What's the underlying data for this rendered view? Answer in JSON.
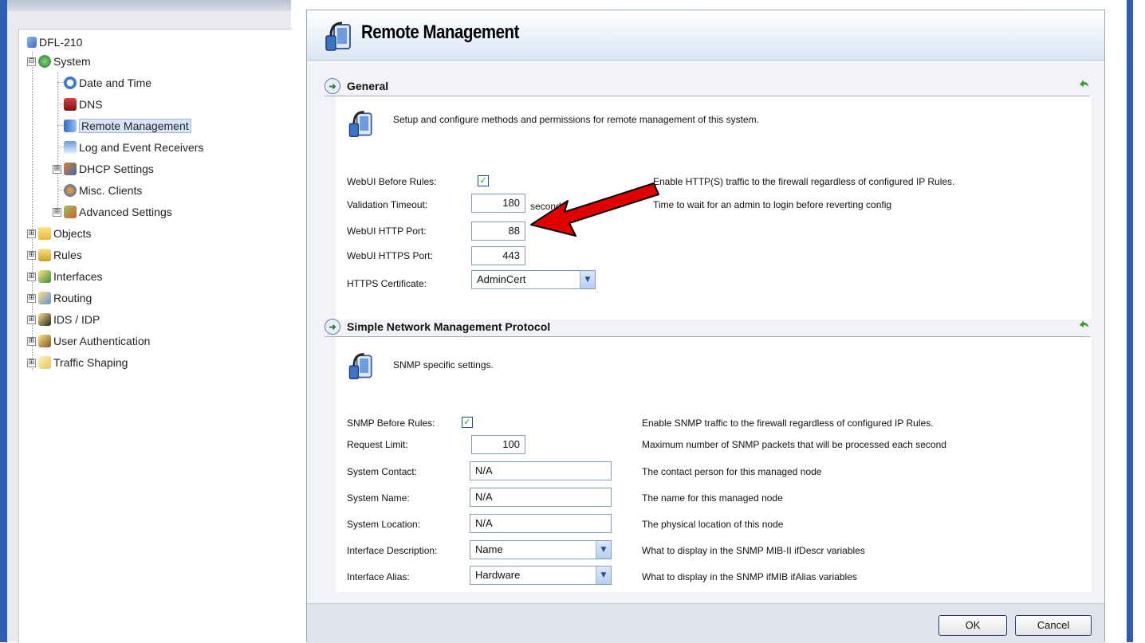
{
  "tree": {
    "root": "DFL-210",
    "items": [
      {
        "label": "System",
        "icon": "system-icon",
        "expander": "⊟"
      },
      {
        "label": "Date and Time",
        "icon": "clock-icon"
      },
      {
        "label": "DNS",
        "icon": "dns-icon"
      },
      {
        "label": "Remote Management",
        "icon": "remote-management-icon",
        "selected": true
      },
      {
        "label": "Log and Event Receivers",
        "icon": "log-icon"
      },
      {
        "label": "DHCP Settings",
        "icon": "dhcp-icon",
        "expander": "⊞"
      },
      {
        "label": "Misc. Clients",
        "icon": "clients-icon"
      },
      {
        "label": "Advanced Settings",
        "icon": "advanced-settings-icon",
        "expander": "⊞"
      },
      {
        "label": "Objects",
        "icon": "folder-icon",
        "expander": "⊞"
      },
      {
        "label": "Rules",
        "icon": "rules-icon",
        "expander": "⊞"
      },
      {
        "label": "Interfaces",
        "icon": "interfaces-icon",
        "expander": "⊞"
      },
      {
        "label": "Routing",
        "icon": "routing-icon",
        "expander": "⊞"
      },
      {
        "label": "IDS / IDP",
        "icon": "ids-icon",
        "expander": "⊞"
      },
      {
        "label": "User Authentication",
        "icon": "user-auth-icon",
        "expander": "⊞"
      },
      {
        "label": "Traffic Shaping",
        "icon": "traffic-shaping-icon",
        "expander": "⊞"
      }
    ]
  },
  "page": {
    "title": "Remote Management"
  },
  "general": {
    "title": "General",
    "intro": "Setup and configure methods and permissions for remote management of this system.",
    "webui_before_rules": {
      "label": "WebUI Before Rules:",
      "checked": true,
      "desc": "Enable HTTP(S) traffic to the firewall regardless of configured IP Rules."
    },
    "validation_timeout": {
      "label": "Validation Timeout:",
      "value": "180",
      "unit": "seconds",
      "desc": "Time to wait for an admin to login before reverting config"
    },
    "http_port": {
      "label": "WebUI HTTP Port:",
      "value": "88"
    },
    "https_port": {
      "label": "WebUI HTTPS Port:",
      "value": "443"
    },
    "https_cert": {
      "label": "HTTPS Certificate:",
      "value": "AdminCert"
    }
  },
  "snmp": {
    "title": "Simple Network Management Protocol",
    "intro": "SNMP specific settings.",
    "before_rules": {
      "label": "SNMP Before Rules:",
      "checked": true,
      "desc": "Enable SNMP traffic to the firewall regardless of configured IP Rules."
    },
    "request_limit": {
      "label": "Request Limit:",
      "value": "100",
      "desc": "Maximum number of SNMP packets that will be processed each second"
    },
    "contact": {
      "label": "System Contact:",
      "value": "N/A",
      "desc": "The contact person for this managed node"
    },
    "name": {
      "label": "System Name:",
      "value": "N/A",
      "desc": "The name for this managed node"
    },
    "location": {
      "label": "System Location:",
      "value": "N/A",
      "desc": "The physical location of this node"
    },
    "if_desc": {
      "label": "Interface Description:",
      "value": "Name",
      "desc": "What to display in the SNMP MIB-II ifDescr variables"
    },
    "if_alias": {
      "label": "Interface Alias:",
      "value": "Hardware",
      "desc": "What to display in the SNMP ifMIB ifAlias variables"
    }
  },
  "buttons": {
    "ok": "OK",
    "cancel": "Cancel"
  },
  "colors": {
    "annotation_arrow": "#e00000",
    "accent": "#2c5fb3"
  }
}
